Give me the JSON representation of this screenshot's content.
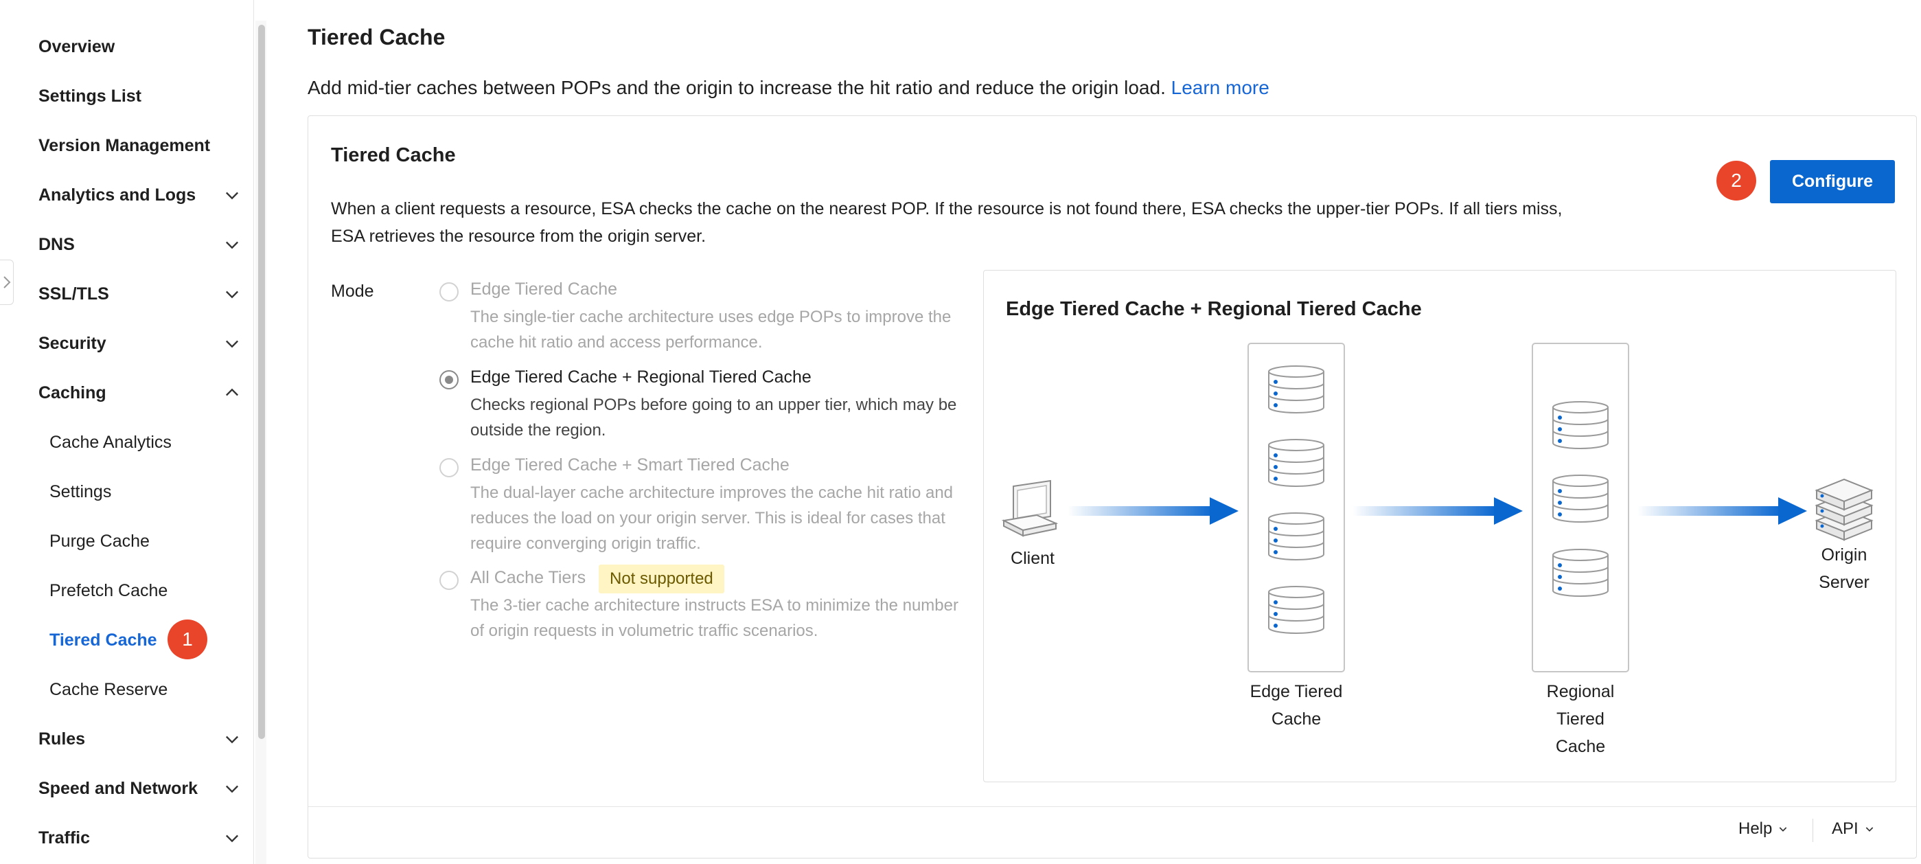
{
  "sidebar": {
    "items": [
      {
        "label": "Overview"
      },
      {
        "label": "Settings List"
      },
      {
        "label": "Version Management"
      },
      {
        "label": "Analytics and Logs"
      },
      {
        "label": "DNS"
      },
      {
        "label": "SSL/TLS"
      },
      {
        "label": "Security"
      },
      {
        "label": "Caching"
      },
      {
        "label": "Rules"
      },
      {
        "label": "Speed and Network"
      },
      {
        "label": "Traffic"
      }
    ],
    "caching_sub": [
      {
        "label": "Cache Analytics"
      },
      {
        "label": "Settings"
      },
      {
        "label": "Purge Cache"
      },
      {
        "label": "Prefetch Cache"
      },
      {
        "label": "Tiered Cache"
      },
      {
        "label": "Cache Reserve"
      }
    ],
    "active_item": "Tiered Cache"
  },
  "annotations": {
    "step1": "1",
    "step2": "2"
  },
  "main": {
    "title": "Tiered Cache",
    "description": "Add mid-tier caches between POPs and the origin to increase the hit ratio and reduce the origin load.",
    "learn_more": "Learn more",
    "card": {
      "title": "Tiered Cache",
      "configure_label": "Configure",
      "description": "When a client requests a resource, ESA checks the cache on the nearest POP. If the resource is not found there, ESA checks the upper-tier POPs. If all tiers miss, ESA retrieves the resource from the origin server.",
      "mode_label": "Mode",
      "modes": [
        {
          "title": "Edge Tiered Cache",
          "desc": "The single-tier cache architecture uses edge POPs to improve the cache hit ratio and access performance.",
          "selected": false,
          "disabled": true
        },
        {
          "title": "Edge Tiered Cache + Regional Tiered Cache",
          "desc": "Checks regional POPs before going to an upper tier, which may be outside the region.",
          "selected": true,
          "disabled": false
        },
        {
          "title": "Edge Tiered Cache + Smart Tiered Cache",
          "desc": "The dual-layer cache architecture improves the cache hit ratio and reduces the load on your origin server. This is ideal for cases that require converging origin traffic.",
          "selected": false,
          "disabled": true
        },
        {
          "title": "All Cache Tiers",
          "desc": "The 3-tier cache architecture instructs ESA to minimize the number of origin requests in volumetric traffic scenarios.",
          "selected": false,
          "disabled": true
        }
      ],
      "not_supported": "Not supported",
      "diagram": {
        "title": "Edge Tiered Cache + Regional Tiered Cache",
        "client": "Client",
        "edge_tiered_line1": "Edge Tiered",
        "edge_tiered_line2": "Cache",
        "regional_line1": "Regional",
        "regional_line2": "Tiered",
        "regional_line3": "Cache",
        "origin_line1": "Origin",
        "origin_line2": "Server"
      }
    },
    "footer": {
      "help": "Help",
      "api": "API"
    }
  },
  "colors": {
    "accent": "#0a67d0",
    "badge": "#e9452a",
    "link": "#1766d6",
    "warning_bg": "#fff4c4"
  }
}
